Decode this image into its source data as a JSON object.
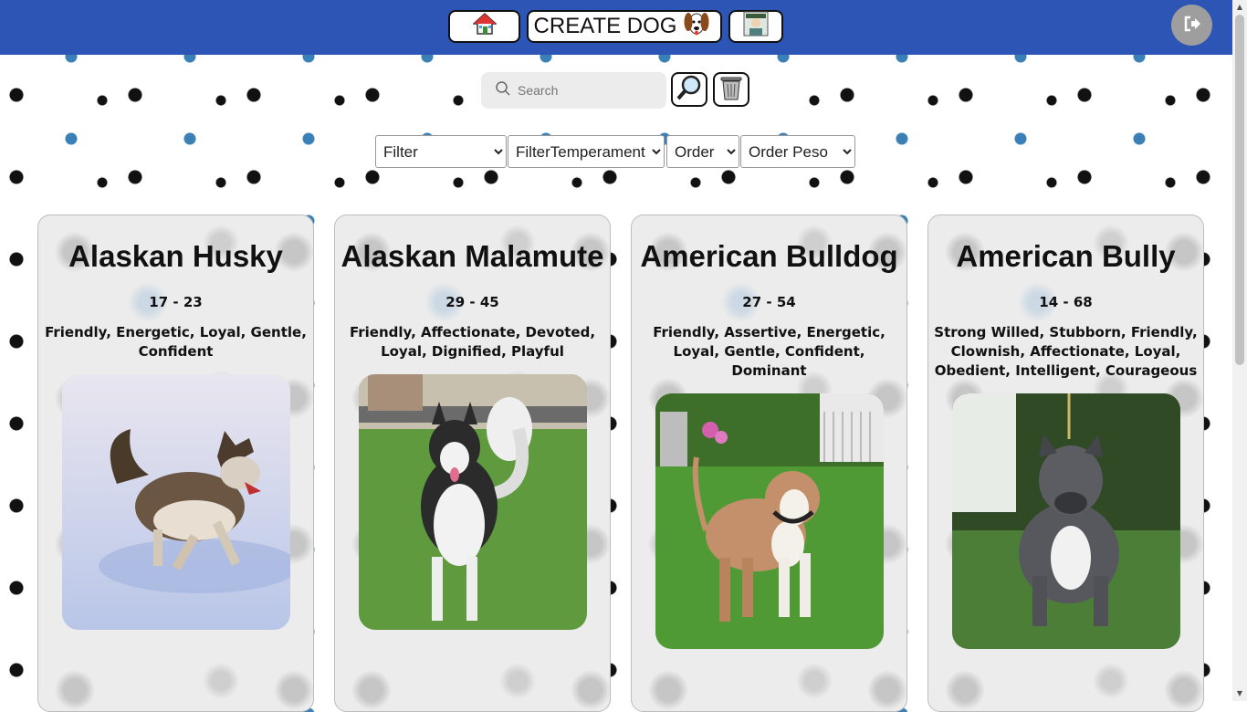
{
  "header": {
    "create_label": "CREATE DOG"
  },
  "search": {
    "placeholder": "Search"
  },
  "filters": {
    "filter": "Filter",
    "filter_temperament": "FilterTemperament",
    "order": "Order",
    "order_weight": "Order Peso"
  },
  "cards": [
    {
      "name": "Alaskan Husky",
      "weight": "17 - 23",
      "temperament": "Friendly, Energetic, Loyal, Gentle, Confident"
    },
    {
      "name": "Alaskan Malamute",
      "weight": "29 - 45",
      "temperament": "Friendly, Affectionate, Devoted, Loyal, Dignified, Playful"
    },
    {
      "name": "American Bulldog",
      "weight": "27 - 54",
      "temperament": "Friendly, Assertive, Energetic, Loyal, Gentle, Confident, Dominant"
    },
    {
      "name": "American Bully",
      "weight": "14 - 68",
      "temperament": "Strong Willed, Stubborn, Friendly, Clownish, Affectionate, Loyal, Obedient, Intelligent, Courageous"
    }
  ],
  "colors": {
    "header_bg": "#2c55b6",
    "logout_bg": "#9e9e9e"
  },
  "icons": {
    "home": "home-icon",
    "dog": "dog-face-icon",
    "profile": "profile-avatar-icon",
    "logout": "logout-icon",
    "search": "magnifier-icon",
    "trash": "trash-can-icon"
  }
}
